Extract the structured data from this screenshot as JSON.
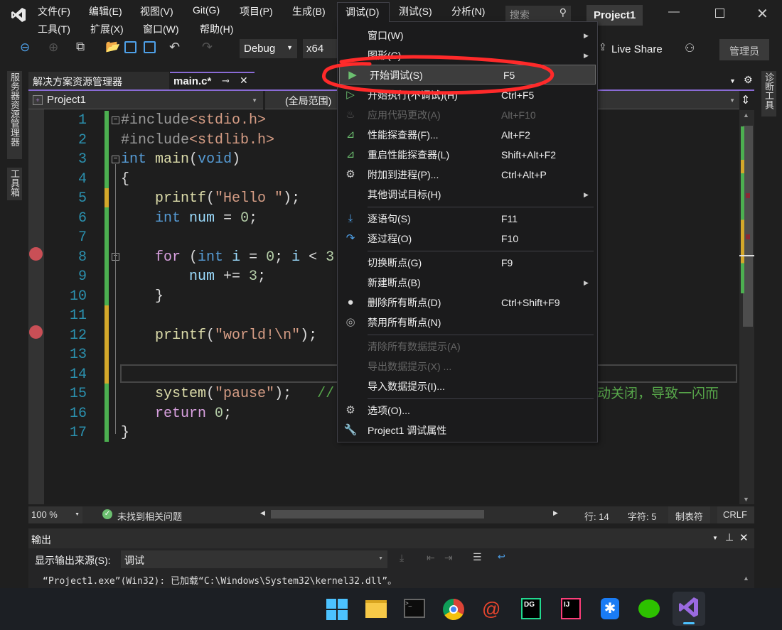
{
  "titlebar": {
    "menus_row1": [
      "文件(F)",
      "编辑(E)",
      "视图(V)",
      "Git(G)",
      "项目(P)",
      "生成(B)",
      "调试(D)",
      "测试(S)",
      "分析(N)"
    ],
    "menus_row2": [
      "工具(T)",
      "扩展(X)",
      "窗口(W)",
      "帮助(H)"
    ],
    "search_placeholder": "搜索",
    "project_name": "Project1",
    "live_share": "Live Share",
    "admin": "管理员"
  },
  "toolbar": {
    "configuration": "Debug",
    "platform": "x64"
  },
  "side_left": [
    "服务器资源管理器",
    "工具箱"
  ],
  "side_right": "诊断工具",
  "tabs": [
    {
      "label": "解决方案资源管理器",
      "active": false
    },
    {
      "label": "main.c*",
      "active": true
    }
  ],
  "navbar": {
    "project": "Project1",
    "scope": "(全局范围)"
  },
  "editor": {
    "line_numbers": [
      "1",
      "2",
      "3",
      "4",
      "5",
      "6",
      "7",
      "8",
      "9",
      "10",
      "11",
      "12",
      "13",
      "14",
      "15",
      "16",
      "17"
    ],
    "breakpoint_lines": [
      8,
      12
    ],
    "current_line": 14,
    "comment_tail": "动关闭，导致一闪而"
  },
  "debug_menu": {
    "items": [
      {
        "icon": "none",
        "label": "窗口(W)",
        "shortcut": "",
        "submenu": true
      },
      {
        "icon": "none",
        "label": "图形(C)",
        "shortcut": "",
        "submenu": true
      },
      {
        "icon": "play-filled",
        "label": "开始调试(S)",
        "shortcut": "F5",
        "highlighted": true
      },
      {
        "icon": "play-outline",
        "label": "开始执行(不调试)(H)",
        "shortcut": "Ctrl+F5"
      },
      {
        "icon": "flame",
        "label": "应用代码更改(A)",
        "shortcut": "Alt+F10",
        "disabled": true
      },
      {
        "icon": "profiler",
        "label": "性能探查器(F)...",
        "shortcut": "Alt+F2"
      },
      {
        "icon": "profiler",
        "label": "重启性能探查器(L)",
        "shortcut": "Shift+Alt+F2"
      },
      {
        "icon": "gears",
        "label": "附加到进程(P)...",
        "shortcut": "Ctrl+Alt+P"
      },
      {
        "icon": "none",
        "label": "其他调试目标(H)",
        "shortcut": "",
        "submenu": true,
        "separator_after": true
      },
      {
        "icon": "step-into",
        "label": "逐语句(S)",
        "shortcut": "F11"
      },
      {
        "icon": "step-over",
        "label": "逐过程(O)",
        "shortcut": "F10",
        "separator_after": true
      },
      {
        "icon": "none",
        "label": "切换断点(G)",
        "shortcut": "F9"
      },
      {
        "icon": "none",
        "label": "新建断点(B)",
        "shortcut": "",
        "submenu": true
      },
      {
        "icon": "delete-breakpoints",
        "label": "删除所有断点(D)",
        "shortcut": "Ctrl+Shift+F9"
      },
      {
        "icon": "disable-breakpoints",
        "label": "禁用所有断点(N)",
        "shortcut": "",
        "separator_after": true
      },
      {
        "icon": "none",
        "label": "清除所有数据提示(A)",
        "shortcut": "",
        "disabled": true
      },
      {
        "icon": "none",
        "label": "导出数据提示(X) ...",
        "shortcut": "",
        "disabled": true
      },
      {
        "icon": "none",
        "label": "导入数据提示(I)...",
        "shortcut": "",
        "separator_after": true
      },
      {
        "icon": "gear",
        "label": "选项(O)...",
        "shortcut": ""
      },
      {
        "icon": "wrench",
        "label": "Project1 调试属性",
        "shortcut": ""
      }
    ]
  },
  "statusbar": {
    "zoom": "100 %",
    "issues": "未找到相关问题",
    "line": "行: 14",
    "char": "字符: 5",
    "indent": "制表符",
    "eol": "CRLF"
  },
  "output": {
    "title": "输出",
    "source_label": "显示输出来源(S):",
    "source_value": "调试",
    "text": "“Project1.exe”(Win32): 已加载“C:\\Windows\\System32\\kernel32.dll”。"
  },
  "taskbar": [
    "windows-start",
    "file-explorer",
    "terminal",
    "chrome",
    "app-swirl",
    "datagrip",
    "intellij",
    "app-star",
    "wechat",
    "visual-studio"
  ],
  "colors": {
    "accent": "#8a6bd6",
    "annotation": "#ff2a2a",
    "change_saved": "#4caf50",
    "change_unsaved": "#d4a82a",
    "breakpoint": "#c94f56"
  }
}
